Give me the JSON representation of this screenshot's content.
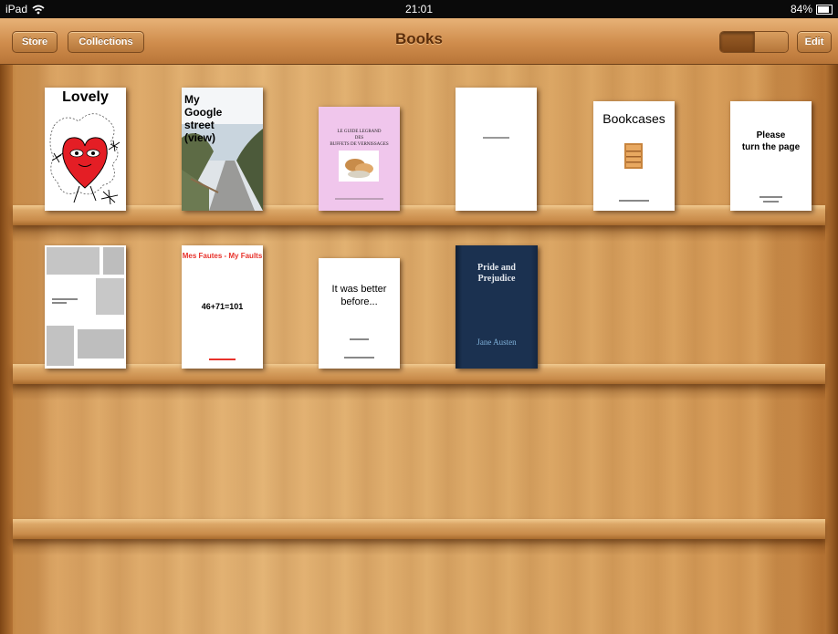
{
  "status": {
    "device": "iPad",
    "time": "21:01",
    "battery": "84%",
    "battery_level": 0.84
  },
  "toolbar": {
    "store_label": "Store",
    "collections_label": "Collections",
    "title": "Books",
    "edit_label": "Edit",
    "view_mode": "grid"
  },
  "books": [
    {
      "title": "Lovely"
    },
    {
      "title_lines": [
        "My",
        "Google",
        "street",
        "(view)"
      ]
    },
    {
      "title_lines": [
        "LE GUIDE LEGRAND",
        "DES",
        "BUFFETS DE VERNISSAGES"
      ]
    },
    {
      "title": ""
    },
    {
      "title": "Bookcases"
    },
    {
      "title_lines": [
        "Please",
        "turn the page"
      ]
    },
    {
      "title": ""
    },
    {
      "title": "Mes Fautes - My Faults",
      "subtitle": "46+71=101"
    },
    {
      "title_lines": [
        "It was better",
        "before..."
      ]
    },
    {
      "title_lines": [
        "Pride and",
        "Prejudice"
      ],
      "author": "Jane Austen"
    }
  ],
  "colors": {
    "toolbar": "#cf8c4c",
    "title_text": "#5c2e0b",
    "shelf_wood": "#e2b273",
    "jane_austen_cover": "#1b3150",
    "faults_red": "#e8322b",
    "lovely_pink": "#f0c6ec"
  }
}
